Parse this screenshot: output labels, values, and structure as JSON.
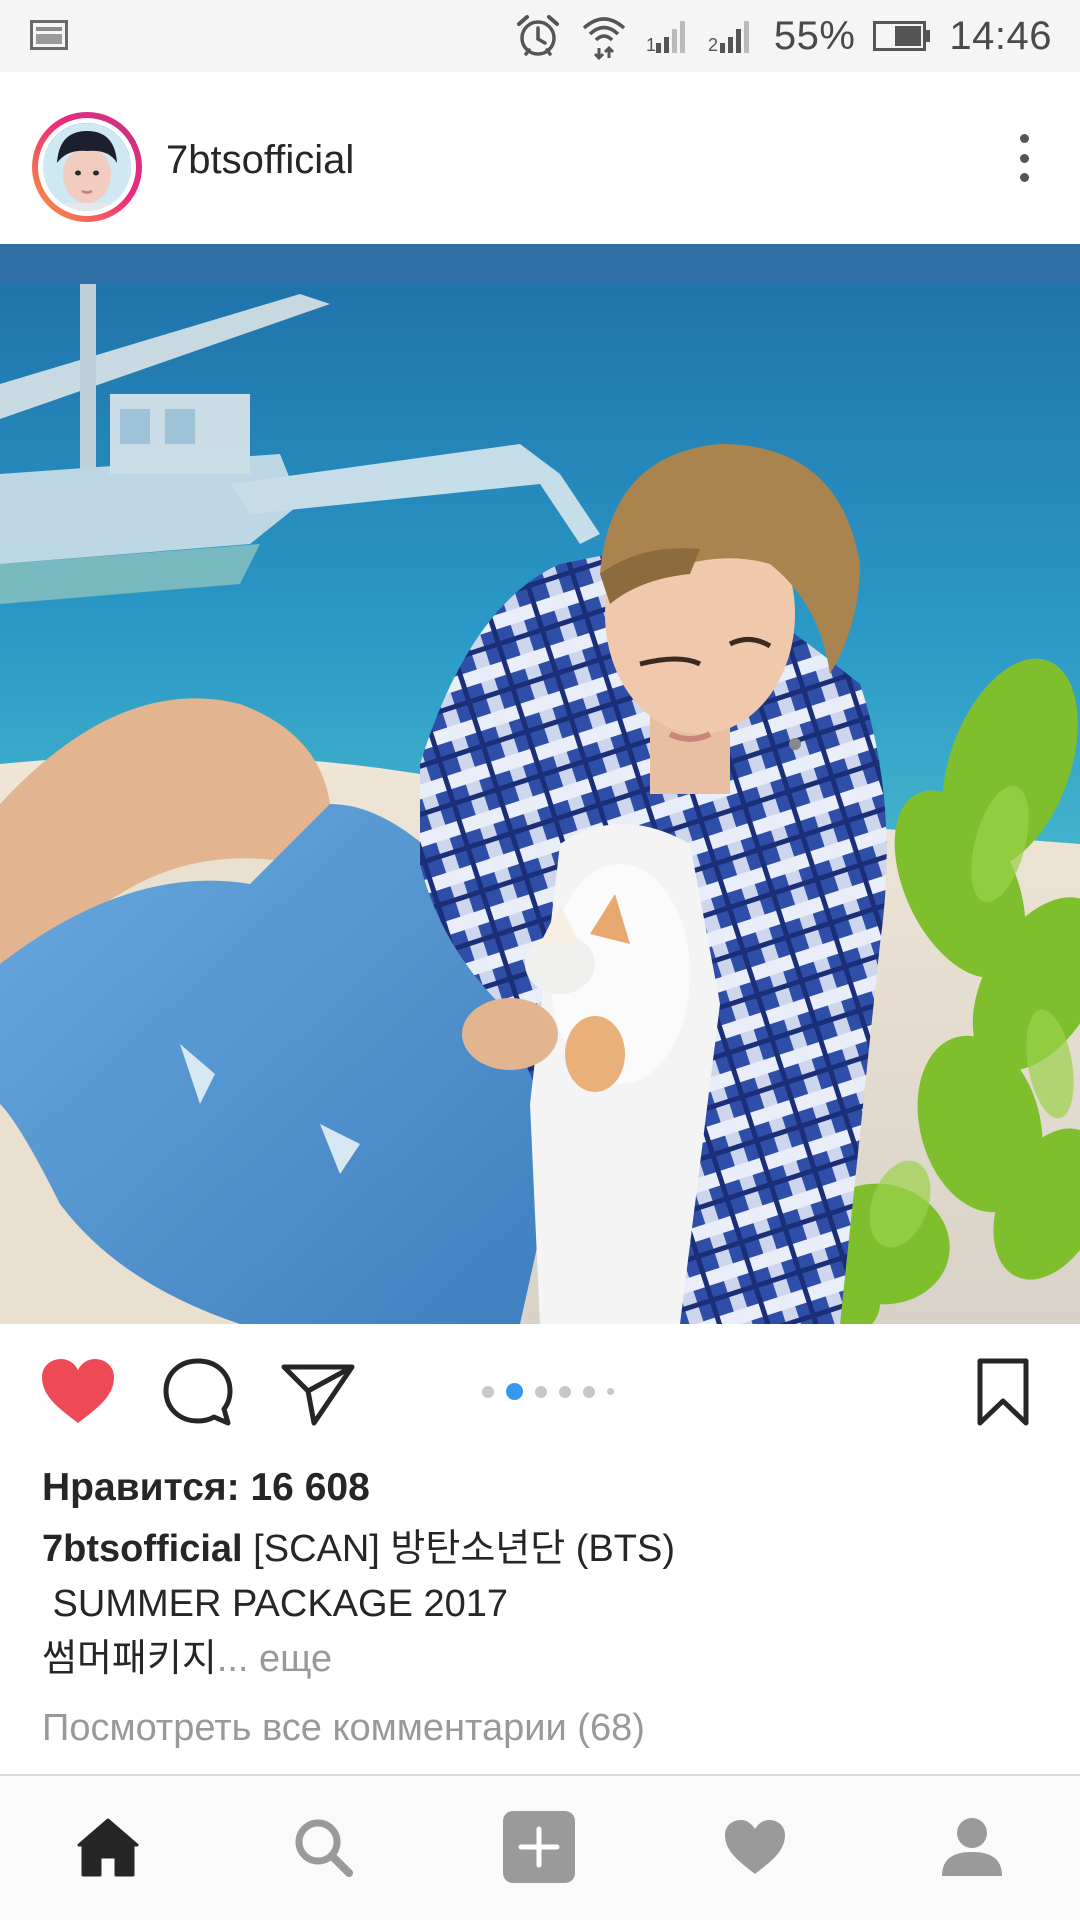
{
  "status_bar": {
    "battery_percent": "55%",
    "time": "14:46",
    "icons": [
      "screenshot-icon",
      "alarm-icon",
      "wifi-icon",
      "signal-1-icon",
      "signal-2-icon",
      "battery-icon"
    ]
  },
  "post": {
    "username": "7btsofficial",
    "avatar_icon": "avatar",
    "menu_icon": "more-vertical-icon",
    "carousel": {
      "total_dots": 6,
      "active_index": 1,
      "active_color": "#3897f0",
      "inactive_color": "#c7c7c7"
    },
    "likes_label": "Нравится: 16 608",
    "caption": {
      "username": "7btsofficial",
      "line1": "[SCAN] 방탄소년단 (BTS)",
      "line2": " SUMMER PACKAGE 2017",
      "line3": "썸머패키지",
      "more_link": "... еще"
    },
    "view_comments": "Посмотреть все комментарии (68)",
    "like_color": "#ed4956"
  },
  "bottom_nav": {
    "items": [
      "home-icon",
      "search-icon",
      "add-post-icon",
      "activity-heart-icon",
      "profile-icon"
    ]
  }
}
